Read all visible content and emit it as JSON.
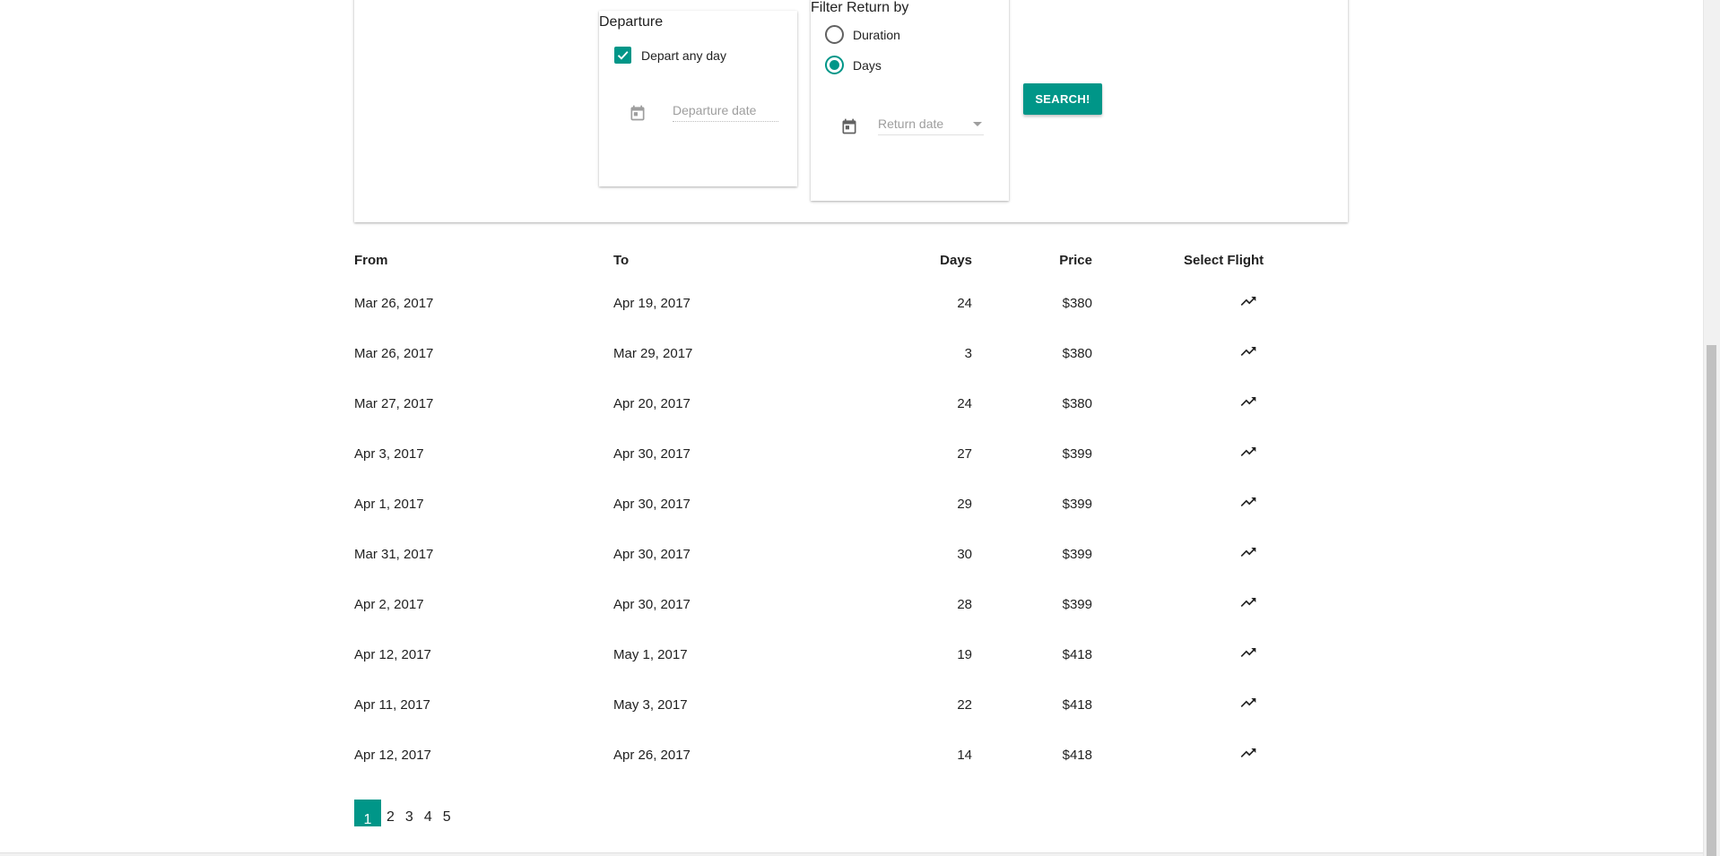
{
  "search": {
    "departure": {
      "title": "Departure",
      "any_day_label": "Depart any day",
      "any_day_checked": true,
      "date_placeholder": "Departure date"
    },
    "return_filter": {
      "title": "Filter Return by",
      "options": [
        {
          "label": "Duration",
          "checked": false
        },
        {
          "label": "Days",
          "checked": true
        }
      ],
      "date_placeholder": "Return date"
    },
    "search_button_label": "SEARCH!"
  },
  "table": {
    "headers": {
      "from": "From",
      "to": "To",
      "days": "Days",
      "price": "Price",
      "select": "Select Flight"
    },
    "rows": [
      {
        "from": "Mar 26, 2017",
        "to": "Apr 19, 2017",
        "days": "24",
        "price": "$380"
      },
      {
        "from": "Mar 26, 2017",
        "to": "Mar 29, 2017",
        "days": "3",
        "price": "$380"
      },
      {
        "from": "Mar 27, 2017",
        "to": "Apr 20, 2017",
        "days": "24",
        "price": "$380"
      },
      {
        "from": "Apr 3, 2017",
        "to": "Apr 30, 2017",
        "days": "27",
        "price": "$399"
      },
      {
        "from": "Apr 1, 2017",
        "to": "Apr 30, 2017",
        "days": "29",
        "price": "$399"
      },
      {
        "from": "Mar 31, 2017",
        "to": "Apr 30, 2017",
        "days": "30",
        "price": "$399"
      },
      {
        "from": "Apr 2, 2017",
        "to": "Apr 30, 2017",
        "days": "28",
        "price": "$399"
      },
      {
        "from": "Apr 12, 2017",
        "to": "May 1, 2017",
        "days": "19",
        "price": "$418"
      },
      {
        "from": "Apr 11, 2017",
        "to": "May 3, 2017",
        "days": "22",
        "price": "$418"
      },
      {
        "from": "Apr 12, 2017",
        "to": "Apr 26, 2017",
        "days": "14",
        "price": "$418"
      }
    ],
    "select_icon": "trending-up-icon"
  },
  "pagination": {
    "pages": [
      "1",
      "2",
      "3",
      "4",
      "5"
    ],
    "current": "1"
  },
  "colors": {
    "accent": "#009688"
  }
}
